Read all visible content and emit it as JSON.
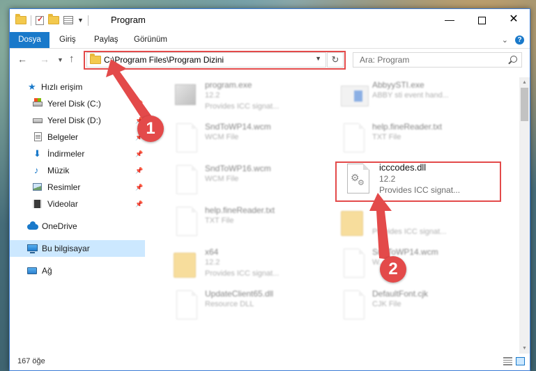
{
  "window": {
    "title": "Program"
  },
  "ribbon": {
    "tabs": [
      "Dosya",
      "Giriş",
      "Paylaş",
      "Görünüm"
    ]
  },
  "address": {
    "path": "C:\\Program Files\\Program Dizini"
  },
  "search": {
    "placeholder": "Ara: Program"
  },
  "sidebar": {
    "items": [
      {
        "label": "Hızlı erişim",
        "icon": "star-icon"
      },
      {
        "label": "Yerel Disk (C:)",
        "icon": "drive-icon"
      },
      {
        "label": "Yerel Disk (D:)",
        "icon": "drive-icon"
      },
      {
        "label": "Belgeler",
        "icon": "documents-icon"
      },
      {
        "label": "İndirmeler",
        "icon": "download-icon"
      },
      {
        "label": "Müzik",
        "icon": "music-icon"
      },
      {
        "label": "Resimler",
        "icon": "pictures-icon"
      },
      {
        "label": "Videolar",
        "icon": "videos-icon"
      },
      {
        "label": "OneDrive",
        "icon": "cloud-icon"
      },
      {
        "label": "Bu bilgisayar",
        "icon": "computer-icon"
      },
      {
        "label": "Ağ",
        "icon": "network-icon"
      }
    ]
  },
  "files": [
    {
      "name": "program.exe",
      "version": "12.2",
      "desc": "Provides ICC signat..."
    },
    {
      "name": "AbbyySTI.exe",
      "version": "ABBY sti event hand..."
    },
    {
      "name": "SndToWP14.wcm",
      "type": "WCM File"
    },
    {
      "name": "help.fineReader.txt",
      "type": "TXT File"
    },
    {
      "name": "SndToWP16.wcm",
      "type": "WCM File"
    },
    {
      "name": "help.fineReader.txt",
      "type": "TXT File"
    },
    {
      "name": "x64",
      "version": "12.2",
      "desc": "Provides ICC signat..."
    },
    {
      "name": "Provides ICC signat..."
    },
    {
      "name": "SndToWP14.wcm",
      "type": "W..."
    },
    {
      "name": "UpdateClient65.dll",
      "type": "Resource DLL"
    },
    {
      "name": "DefaultFont.cjk",
      "type": "CJK File"
    }
  ],
  "highlighted_file": {
    "name": "icccodes.dll",
    "version": "12.2",
    "desc": "Provides ICC signat..."
  },
  "status": {
    "count": "167 öğe"
  },
  "callouts": [
    "1",
    "2"
  ],
  "colors": {
    "accent": "#1979ca",
    "highlight": "#e34a4a",
    "selected": "#cce8ff"
  }
}
